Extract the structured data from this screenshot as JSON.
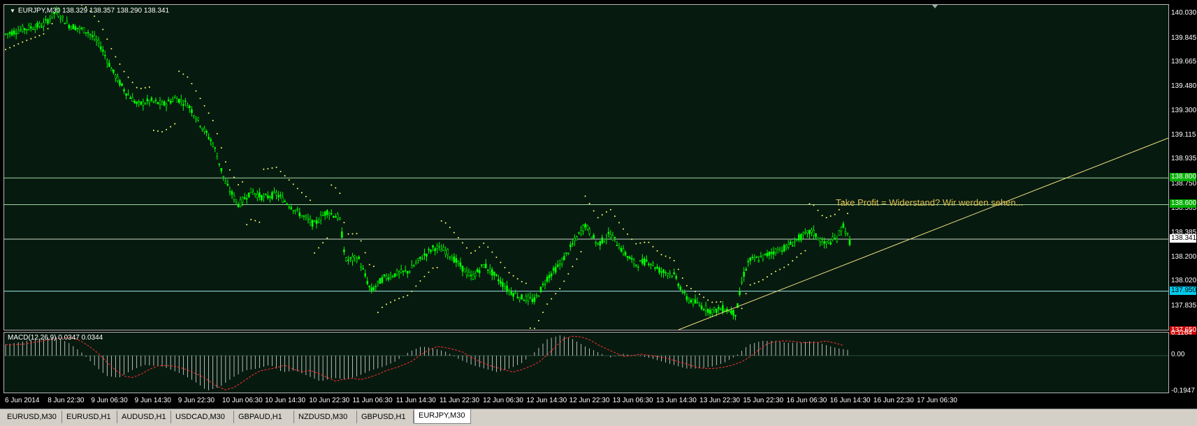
{
  "window": {
    "title": "EURJPY,M30  138.329 138.357 138.290 138.341",
    "annotation": "Take Profit = Widerstand? Wir werden sehen..."
  },
  "price_axis": {
    "labels": [
      "140.030",
      "139.845",
      "139.665",
      "139.480",
      "139.300",
      "139.115",
      "138.935",
      "138.750",
      "138.565",
      "138.385",
      "138.200",
      "138.020",
      "137.835"
    ],
    "tags": {
      "upper_level": {
        "text": "138.800",
        "color": "#00c000"
      },
      "take_profit": {
        "text": "138.600",
        "color": "#00c000"
      },
      "current": {
        "text": "138.341",
        "color": "#ffffff"
      },
      "support": {
        "text": "137.950",
        "color": "#00ccff"
      },
      "stop": {
        "text": "137.650",
        "color": "#d00000"
      }
    }
  },
  "macd": {
    "label": "MACD(12,26,9) 0.0347 0.0344",
    "axis_labels": [
      "0.1164",
      "0.00",
      "-0.1947"
    ]
  },
  "time_axis": {
    "labels": [
      "6 Jun 2014",
      "8 Jun 22:30",
      "9 Jun 06:30",
      "9 Jun 14:30",
      "9 Jun 22:30",
      "10 Jun 06:30",
      "10 Jun 14:30",
      "10 Jun 22:30",
      "11 Jun 06:30",
      "11 Jun 14:30",
      "11 Jun 22:30",
      "12 Jun 06:30",
      "12 Jun 14:30",
      "12 Jun 22:30",
      "13 Jun 06:30",
      "13 Jun 14:30",
      "13 Jun 22:30",
      "15 Jun 22:30",
      "16 Jun 06:30",
      "16 Jun 14:30",
      "16 Jun 22:30",
      "17 Jun 06:30"
    ]
  },
  "tabs": [
    {
      "label": "EURUSD,M30",
      "active": false
    },
    {
      "label": "EURUSD,H1",
      "active": false
    },
    {
      "label": "AUDUSD,H1",
      "active": false
    },
    {
      "label": "USDCAD,M30",
      "active": false
    },
    {
      "label": "GBPAUD,H1",
      "active": false
    },
    {
      "label": "NZDUSD,M30",
      "active": false
    },
    {
      "label": "GBPUSD,H1",
      "active": false
    },
    {
      "label": "EURJPY,M30",
      "active": true
    }
  ],
  "chart_data": {
    "type": "candlestick",
    "symbol": "EURJPY",
    "timeframe": "M30",
    "ylim": [
      137.66,
      140.1
    ],
    "colors": {
      "background": "#071a10",
      "candles": "#00ff00",
      "parabolic_sar": "#ffff66",
      "lines": "#b0e0b0",
      "trendline": "#f0e080",
      "macd_hist": "#ffffff",
      "macd_signal": "#ff3030"
    },
    "horizontal_levels": [
      138.8,
      138.6,
      138.341,
      137.95,
      137.65
    ],
    "price_path": [
      [
        0,
        139.88
      ],
      [
        3,
        139.92
      ],
      [
        6,
        139.95
      ],
      [
        8,
        140.05
      ],
      [
        10,
        139.95
      ],
      [
        13,
        139.9
      ],
      [
        15,
        139.8
      ],
      [
        17,
        139.6
      ],
      [
        19,
        139.45
      ],
      [
        21,
        139.35
      ],
      [
        23,
        139.38
      ],
      [
        25,
        139.35
      ],
      [
        27,
        139.4
      ],
      [
        29,
        139.35
      ],
      [
        31,
        139.2
      ],
      [
        33,
        139.05
      ],
      [
        35,
        138.75
      ],
      [
        37,
        138.6
      ],
      [
        39,
        138.7
      ],
      [
        41,
        138.65
      ],
      [
        43,
        138.68
      ],
      [
        45,
        138.6
      ],
      [
        47,
        138.52
      ],
      [
        49,
        138.45
      ],
      [
        51,
        138.55
      ],
      [
        53,
        138.5
      ],
      [
        54,
        138.18
      ],
      [
        56,
        138.2
      ],
      [
        58,
        137.95
      ],
      [
        60,
        138.05
      ],
      [
        62,
        138.08
      ],
      [
        64,
        138.1
      ],
      [
        66,
        138.2
      ],
      [
        68,
        138.28
      ],
      [
        70,
        138.25
      ],
      [
        72,
        138.15
      ],
      [
        74,
        138.05
      ],
      [
        76,
        138.15
      ],
      [
        78,
        138.05
      ],
      [
        80,
        137.95
      ],
      [
        82,
        137.9
      ],
      [
        84,
        137.88
      ],
      [
        86,
        138.05
      ],
      [
        88,
        138.15
      ],
      [
        90,
        138.3
      ],
      [
        92,
        138.45
      ],
      [
        94,
        138.3
      ],
      [
        96,
        138.38
      ],
      [
        98,
        138.25
      ],
      [
        100,
        138.15
      ],
      [
        102,
        138.18
      ],
      [
        104,
        138.1
      ],
      [
        106,
        138.08
      ],
      [
        108,
        137.9
      ],
      [
        110,
        137.85
      ],
      [
        112,
        137.8
      ],
      [
        114,
        137.82
      ],
      [
        116,
        137.78
      ],
      [
        117,
        138.05
      ],
      [
        118,
        138.18
      ],
      [
        120,
        138.2
      ],
      [
        122,
        138.25
      ],
      [
        124,
        138.28
      ],
      [
        126,
        138.35
      ],
      [
        128,
        138.4
      ],
      [
        130,
        138.3
      ],
      [
        132,
        138.35
      ],
      [
        133,
        138.45
      ],
      [
        134,
        138.32
      ]
    ],
    "macd_path": [
      [
        0,
        0.06
      ],
      [
        5,
        0.09
      ],
      [
        8,
        0.1
      ],
      [
        10,
        0.07
      ],
      [
        12,
        0.02
      ],
      [
        14,
        -0.05
      ],
      [
        16,
        -0.11
      ],
      [
        18,
        -0.12
      ],
      [
        20,
        -0.08
      ],
      [
        22,
        -0.05
      ],
      [
        25,
        -0.06
      ],
      [
        28,
        -0.1
      ],
      [
        30,
        -0.14
      ],
      [
        32,
        -0.19
      ],
      [
        34,
        -0.17
      ],
      [
        36,
        -0.12
      ],
      [
        38,
        -0.08
      ],
      [
        40,
        -0.07
      ],
      [
        42,
        -0.05
      ],
      [
        44,
        -0.09
      ],
      [
        46,
        -0.08
      ],
      [
        48,
        -0.11
      ],
      [
        50,
        -0.14
      ],
      [
        52,
        -0.12
      ],
      [
        54,
        -0.13
      ],
      [
        56,
        -0.11
      ],
      [
        58,
        -0.08
      ],
      [
        60,
        -0.06
      ],
      [
        62,
        -0.03
      ],
      [
        64,
        0.02
      ],
      [
        66,
        0.05
      ],
      [
        68,
        0.04
      ],
      [
        70,
        0.02
      ],
      [
        72,
        -0.02
      ],
      [
        74,
        -0.05
      ],
      [
        76,
        -0.07
      ],
      [
        78,
        -0.09
      ],
      [
        80,
        -0.07
      ],
      [
        82,
        -0.04
      ],
      [
        84,
        0.02
      ],
      [
        86,
        0.09
      ],
      [
        88,
        0.11
      ],
      [
        90,
        0.09
      ],
      [
        92,
        0.05
      ],
      [
        94,
        0.02
      ],
      [
        96,
        -0.01
      ],
      [
        98,
        0.01
      ],
      [
        100,
        0.0
      ],
      [
        102,
        -0.01
      ],
      [
        104,
        -0.03
      ],
      [
        106,
        -0.05
      ],
      [
        108,
        -0.07
      ],
      [
        110,
        -0.07
      ],
      [
        112,
        -0.06
      ],
      [
        114,
        -0.04
      ],
      [
        116,
        0.0
      ],
      [
        118,
        0.06
      ],
      [
        120,
        0.08
      ],
      [
        122,
        0.08
      ],
      [
        124,
        0.07
      ],
      [
        126,
        0.07
      ],
      [
        128,
        0.08
      ],
      [
        130,
        0.06
      ],
      [
        132,
        0.04
      ],
      [
        134,
        0.03
      ]
    ]
  }
}
